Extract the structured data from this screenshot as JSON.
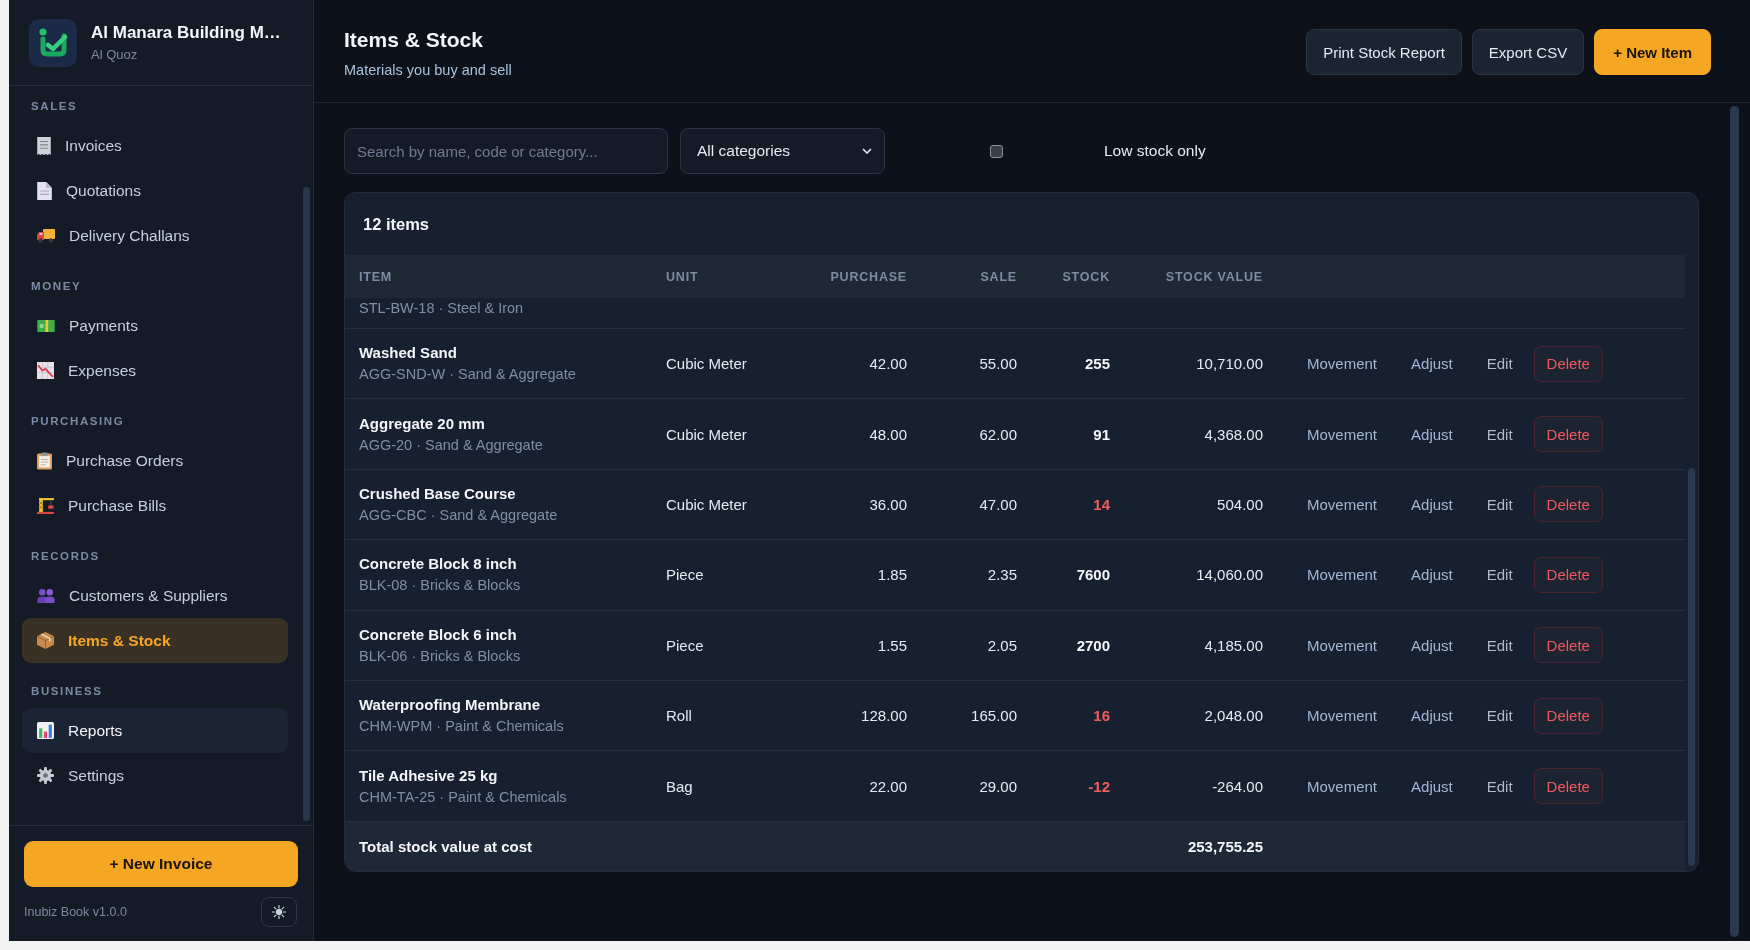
{
  "brand": {
    "name": "Al Manara Building M…",
    "branch": "Al Quoz"
  },
  "sidebar": {
    "sections": [
      {
        "title": "SALES",
        "items": [
          {
            "label": "Invoices",
            "selected": false,
            "hovered": false
          },
          {
            "label": "Quotations",
            "selected": false,
            "hovered": false
          },
          {
            "label": "Delivery Challans",
            "selected": false,
            "hovered": false
          }
        ]
      },
      {
        "title": "MONEY",
        "items": [
          {
            "label": "Payments",
            "selected": false,
            "hovered": false
          },
          {
            "label": "Expenses",
            "selected": false,
            "hovered": false
          }
        ]
      },
      {
        "title": "PURCHASING",
        "items": [
          {
            "label": "Purchase Orders",
            "selected": false,
            "hovered": false
          },
          {
            "label": "Purchase Bills",
            "selected": false,
            "hovered": false
          }
        ]
      },
      {
        "title": "RECORDS",
        "items": [
          {
            "label": "Customers & Suppliers",
            "selected": false,
            "hovered": false
          },
          {
            "label": "Items & Stock",
            "selected": true,
            "hovered": false
          }
        ]
      },
      {
        "title": "BUSINESS",
        "items": [
          {
            "label": "Reports",
            "selected": false,
            "hovered": true
          },
          {
            "label": "Settings",
            "selected": false,
            "hovered": false
          }
        ]
      }
    ],
    "primary_action": "+ New Invoice",
    "version": "Inubiz Book v1.0.0"
  },
  "header": {
    "title": "Items & Stock",
    "subtitle": "Materials you buy and sell",
    "actions": [
      {
        "label": "Print Stock Report",
        "kind": "secondary"
      },
      {
        "label": "Export CSV",
        "kind": "secondary"
      },
      {
        "label": "+ New Item",
        "kind": "primary"
      }
    ]
  },
  "filters": {
    "search": {
      "placeholder": "Search by name, code or category..."
    },
    "category": {
      "value": "All categories"
    },
    "low_stock_only": {
      "label": "Low stock only",
      "checked": false
    }
  },
  "table": {
    "title": "12 items",
    "columns": [
      "ITEM",
      "UNIT",
      "PURCHASE",
      "SALE",
      "STOCK",
      "STOCK VALUE"
    ],
    "clipped_row": {
      "meta": "STL-BW-18 · Steel & Iron"
    },
    "rows": [
      {
        "name": "Washed Sand",
        "meta": "AGG-SND-W · Sand & Aggregate",
        "unit": "Cubic Meter",
        "purchase": "42.00",
        "sale": "55.00",
        "stock": "255",
        "low": false,
        "value": "10,710.00",
        "actions": [
          {
            "label": "Movement",
            "kind": "link"
          },
          {
            "label": "Adjust",
            "kind": "link"
          },
          {
            "label": "Edit",
            "kind": "muted"
          },
          {
            "label": "Delete",
            "kind": "danger"
          }
        ]
      },
      {
        "name": "Aggregate 20 mm",
        "meta": "AGG-20 · Sand & Aggregate",
        "unit": "Cubic Meter",
        "purchase": "48.00",
        "sale": "62.00",
        "stock": "91",
        "low": false,
        "value": "4,368.00",
        "actions": [
          {
            "label": "Movement",
            "kind": "link"
          },
          {
            "label": "Adjust",
            "kind": "link"
          },
          {
            "label": "Edit",
            "kind": "muted"
          },
          {
            "label": "Delete",
            "kind": "danger"
          }
        ]
      },
      {
        "name": "Crushed Base Course",
        "meta": "AGG-CBC · Sand & Aggregate",
        "unit": "Cubic Meter",
        "purchase": "36.00",
        "sale": "47.00",
        "stock": "14",
        "low": true,
        "value": "504.00",
        "actions": [
          {
            "label": "Movement",
            "kind": "link"
          },
          {
            "label": "Adjust",
            "kind": "link"
          },
          {
            "label": "Edit",
            "kind": "muted"
          },
          {
            "label": "Delete",
            "kind": "danger"
          }
        ]
      },
      {
        "name": "Concrete Block 8 inch",
        "meta": "BLK-08 · Bricks & Blocks",
        "unit": "Piece",
        "purchase": "1.85",
        "sale": "2.35",
        "stock": "7600",
        "low": false,
        "value": "14,060.00",
        "actions": [
          {
            "label": "Movement",
            "kind": "link"
          },
          {
            "label": "Adjust",
            "kind": "link"
          },
          {
            "label": "Edit",
            "kind": "muted"
          },
          {
            "label": "Delete",
            "kind": "danger"
          }
        ]
      },
      {
        "name": "Concrete Block 6 inch",
        "meta": "BLK-06 · Bricks & Blocks",
        "unit": "Piece",
        "purchase": "1.55",
        "sale": "2.05",
        "stock": "2700",
        "low": false,
        "value": "4,185.00",
        "actions": [
          {
            "label": "Movement",
            "kind": "link"
          },
          {
            "label": "Adjust",
            "kind": "link"
          },
          {
            "label": "Edit",
            "kind": "muted"
          },
          {
            "label": "Delete",
            "kind": "danger"
          }
        ]
      },
      {
        "name": "Waterproofing Membrane",
        "meta": "CHM-WPM · Paint & Chemicals",
        "unit": "Roll",
        "purchase": "128.00",
        "sale": "165.00",
        "stock": "16",
        "low": true,
        "value": "2,048.00",
        "actions": [
          {
            "label": "Movement",
            "kind": "link"
          },
          {
            "label": "Adjust",
            "kind": "link"
          },
          {
            "label": "Edit",
            "kind": "muted"
          },
          {
            "label": "Delete",
            "kind": "danger"
          }
        ]
      },
      {
        "name": "Tile Adhesive 25 kg",
        "meta": "CHM-TA-25 · Paint & Chemicals",
        "unit": "Bag",
        "purchase": "22.00",
        "sale": "29.00",
        "stock": "-12",
        "low": true,
        "value": "-264.00",
        "actions": [
          {
            "label": "Movement",
            "kind": "link"
          },
          {
            "label": "Adjust",
            "kind": "link"
          },
          {
            "label": "Edit",
            "kind": "muted"
          },
          {
            "label": "Delete",
            "kind": "danger"
          }
        ]
      }
    ],
    "footer": {
      "label": "Total stock value at cost",
      "value": "253,755.25"
    }
  }
}
